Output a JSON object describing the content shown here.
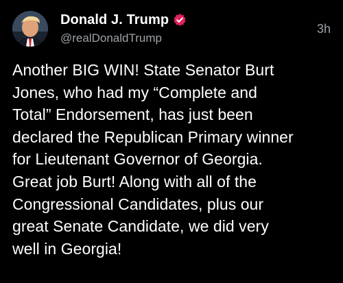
{
  "post": {
    "author": {
      "display_name": "Donald J. Trump",
      "handle": "@realDonaldTrump",
      "avatar_icon": "profile-photo",
      "verified_icon": "verified-badge-icon",
      "verified_color": "#e0245e"
    },
    "timestamp": "3h",
    "lines": [
      "Another BIG WIN! State Senator Burt",
      "Jones, who had my “Complete and",
      "Total” Endorsement, has just been",
      "declared the Republican Primary winner",
      "for Lieutenant Governor of Georgia.",
      "Great job Burt! Along with all of the",
      "Congressional Candidates, plus our",
      "great Senate Candidate, we did very",
      "well in Georgia!"
    ]
  },
  "colors": {
    "background": "#000000",
    "text": "#ffffff",
    "muted": "#9ea3a9"
  }
}
